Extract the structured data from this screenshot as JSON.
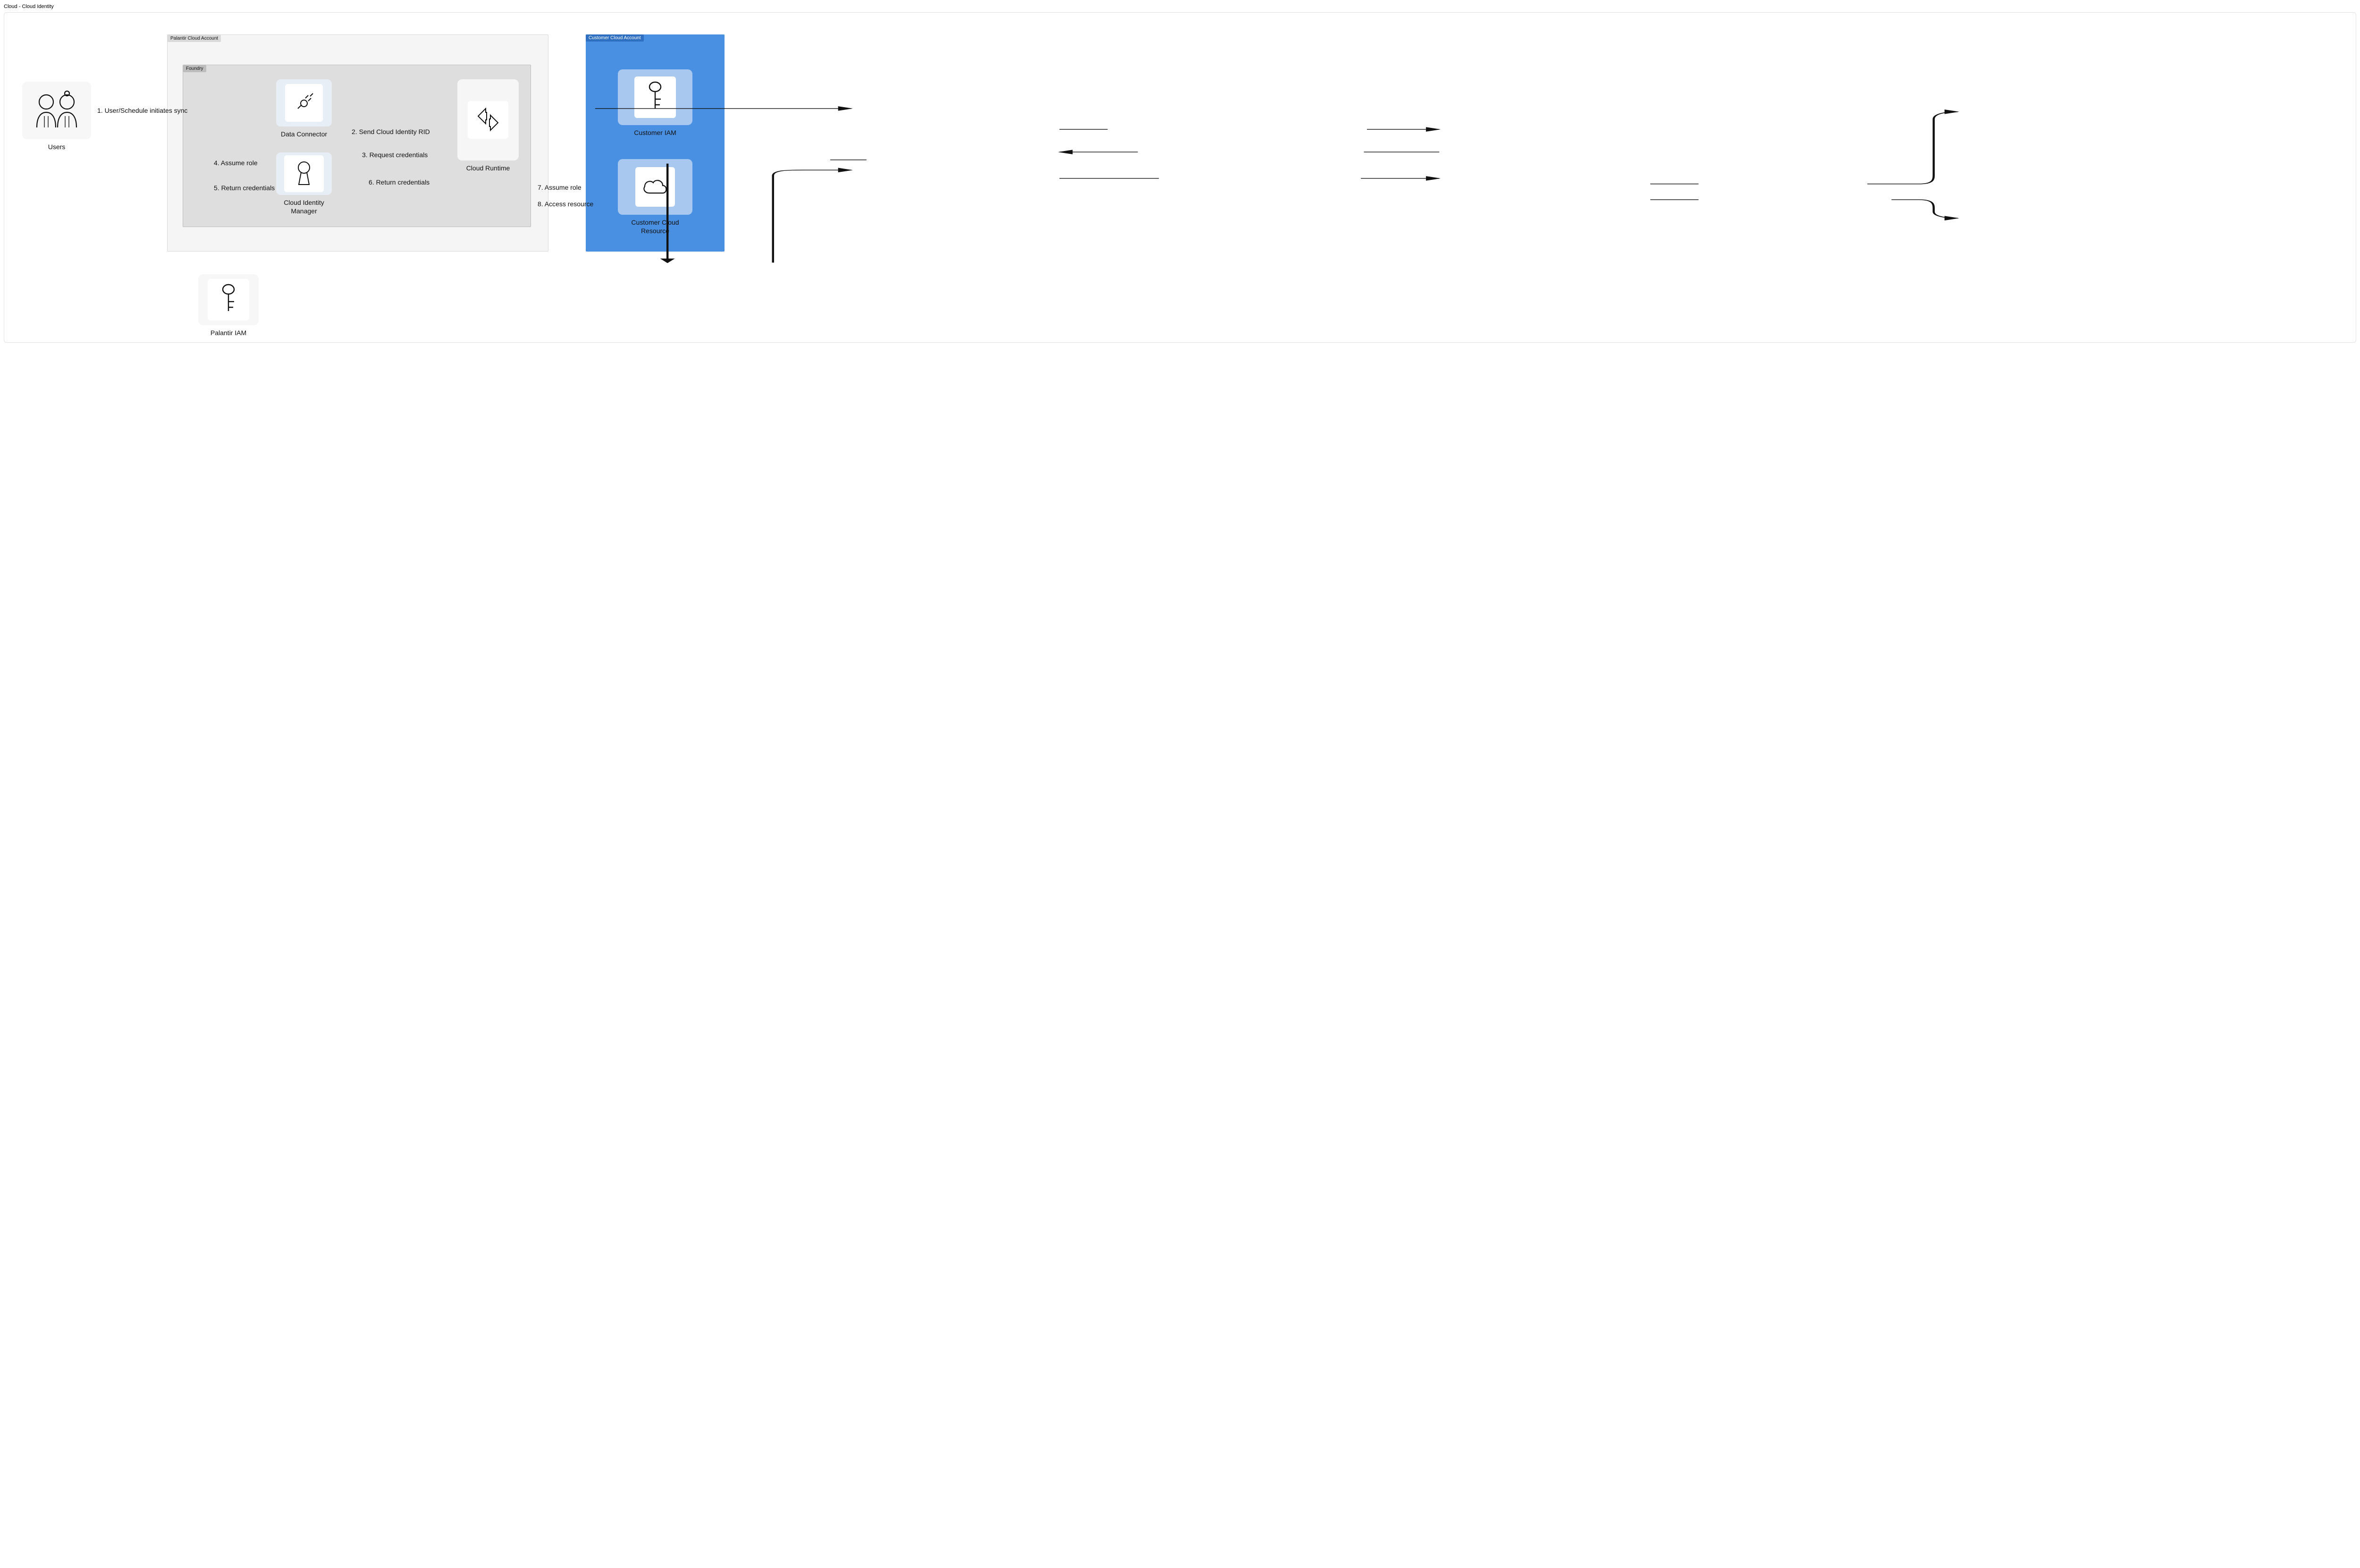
{
  "page": {
    "title": "Cloud - Cloud Identity"
  },
  "regions": {
    "palantir_account": "Palantir Cloud Account",
    "foundry": "Foundry",
    "customer_account": "Customer Cloud Account"
  },
  "nodes": {
    "users": "Users",
    "data_connector": "Data Connector",
    "cloud_identity_manager": "Cloud Identity\nManager",
    "cloud_runtime": "Cloud Runtime",
    "palantir_iam": "Palantir IAM",
    "customer_iam": "Customer IAM",
    "customer_cloud_resource": "Customer Cloud\nResource"
  },
  "steps": {
    "s1": "1. User/Schedule initiates sync",
    "s2": "2. Send Cloud Identity RID",
    "s3": "3. Request credentials",
    "s4": "4. Assume role",
    "s5": "5. Return credentials",
    "s6": "6. Return credentials",
    "s7": "7. Assume role",
    "s8": "8. Access resource"
  }
}
